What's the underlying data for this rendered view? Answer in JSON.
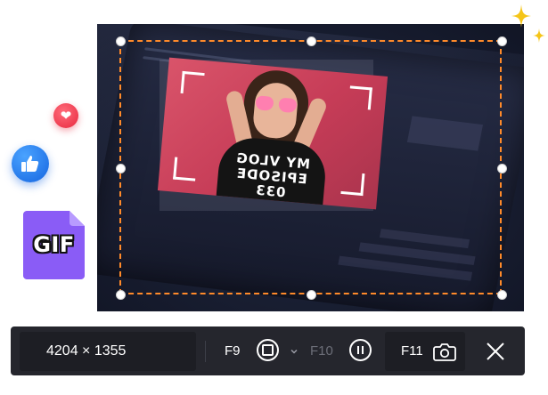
{
  "toolbar": {
    "size_text": "4204 × 1355",
    "record_hotkey": "F9",
    "pause_hotkey": "F10",
    "screenshot_hotkey": "F11"
  },
  "video": {
    "shirt_line1": "MY VLOG",
    "shirt_line2": "EPISODE 033"
  },
  "badges": {
    "file_format": "GIF"
  },
  "icons": {
    "heart": "heart-icon",
    "like": "thumbs-up-icon",
    "gif": "gif-file-icon",
    "sparkle": "sparkle-icon",
    "record": "record-stop-icon",
    "pause": "pause-icon",
    "dropdown": "chevron-down-icon",
    "camera": "camera-icon",
    "close": "close-icon"
  },
  "colors": {
    "selection_border": "#ff8a2a",
    "toolbar_bg": "#25262d",
    "gif_file": "#8a5cf6",
    "sparkle": "#f5c518"
  }
}
